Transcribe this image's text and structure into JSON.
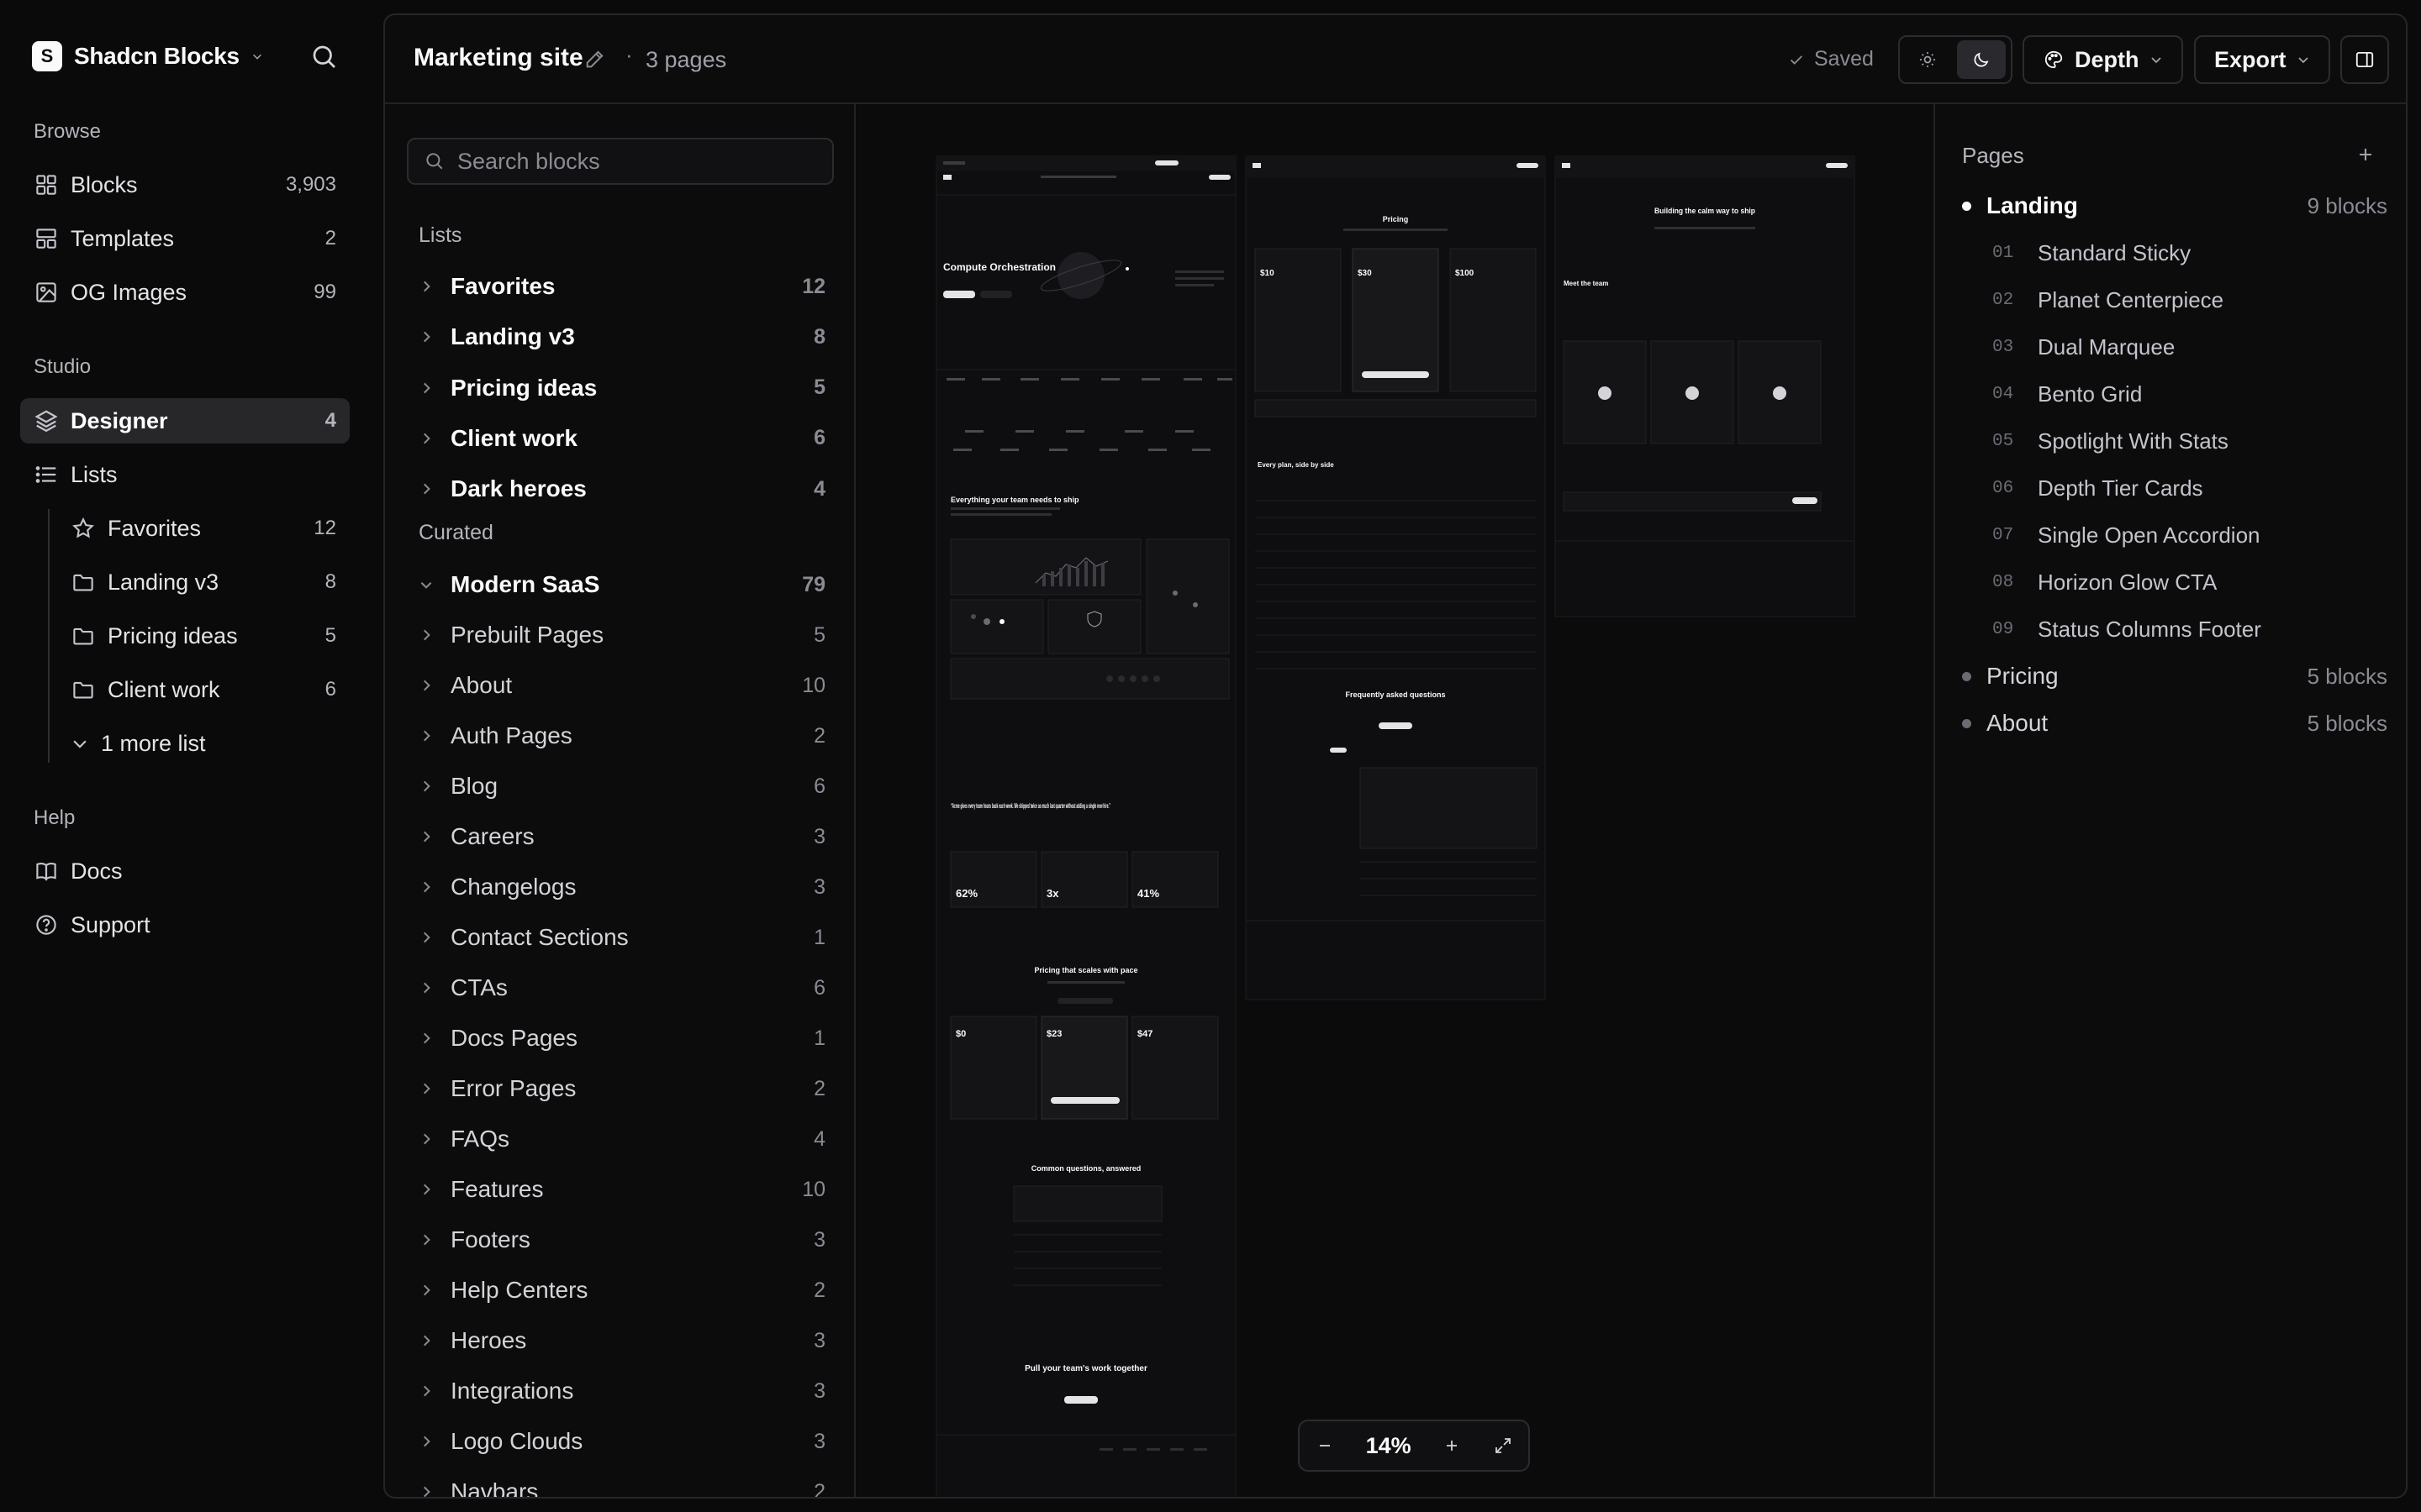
{
  "brand": {
    "logo_letter": "S",
    "name": "Shadcn Blocks"
  },
  "sidebar": {
    "browse_label": "Browse",
    "browse": [
      {
        "label": "Blocks",
        "count": "3,903",
        "icon": "grid-icon"
      },
      {
        "label": "Templates",
        "count": "2",
        "icon": "layout-icon"
      },
      {
        "label": "OG Images",
        "count": "99",
        "icon": "image-icon"
      }
    ],
    "studio_label": "Studio",
    "studio": [
      {
        "label": "Designer",
        "count": "4",
        "icon": "layers-icon",
        "active": true
      },
      {
        "label": "Lists",
        "count": "",
        "icon": "list-icon"
      }
    ],
    "lists": [
      {
        "label": "Favorites",
        "count": "12",
        "icon": "star-icon"
      },
      {
        "label": "Landing v3",
        "count": "8",
        "icon": "folder-icon"
      },
      {
        "label": "Pricing ideas",
        "count": "5",
        "icon": "folder-icon"
      },
      {
        "label": "Client work",
        "count": "6",
        "icon": "folder-icon"
      }
    ],
    "more_lists": "1 more list",
    "help_label": "Help",
    "help": [
      {
        "label": "Docs",
        "icon": "book-icon"
      },
      {
        "label": "Support",
        "icon": "help-circle-icon"
      }
    ]
  },
  "topbar": {
    "title": "Marketing site",
    "separator": "·",
    "pages": "3 pages",
    "saved": "Saved",
    "depth": "Depth",
    "export": "Export"
  },
  "blocks": {
    "search_placeholder": "Search blocks",
    "lists_label": "Lists",
    "lists": [
      {
        "label": "Favorites",
        "count": "12"
      },
      {
        "label": "Landing v3",
        "count": "8"
      },
      {
        "label": "Pricing ideas",
        "count": "5"
      },
      {
        "label": "Client work",
        "count": "6"
      },
      {
        "label": "Dark heroes",
        "count": "4"
      }
    ],
    "curated_label": "Curated",
    "curated": [
      {
        "label": "Modern SaaS",
        "count": "79",
        "open": true
      },
      {
        "label": "Prebuilt Pages",
        "count": "5"
      },
      {
        "label": "About",
        "count": "10"
      },
      {
        "label": "Auth Pages",
        "count": "2"
      },
      {
        "label": "Blog",
        "count": "6"
      },
      {
        "label": "Careers",
        "count": "3"
      },
      {
        "label": "Changelogs",
        "count": "3"
      },
      {
        "label": "Contact Sections",
        "count": "1"
      },
      {
        "label": "CTAs",
        "count": "6"
      },
      {
        "label": "Docs Pages",
        "count": "1"
      },
      {
        "label": "Error Pages",
        "count": "2"
      },
      {
        "label": "FAQs",
        "count": "4"
      },
      {
        "label": "Features",
        "count": "10"
      },
      {
        "label": "Footers",
        "count": "3"
      },
      {
        "label": "Help Centers",
        "count": "2"
      },
      {
        "label": "Heroes",
        "count": "3"
      },
      {
        "label": "Integrations",
        "count": "3"
      },
      {
        "label": "Logo Clouds",
        "count": "3"
      },
      {
        "label": "Navbars",
        "count": "2"
      }
    ]
  },
  "canvas": {
    "landing": {
      "hero": "Compute Orchestration",
      "features": "Everything your team needs to ship",
      "quote": "“Acme gives every team hours back each week. We shipped twice as much last quarter without adding a single new hire.”",
      "stats": [
        "62%",
        "3x",
        "41%"
      ],
      "pricing": "Pricing that scales with pace",
      "prices": [
        "$0",
        "$23",
        "$47"
      ],
      "faq": "Common questions, answered",
      "cta": "Pull your team's work together"
    },
    "pricing_page": {
      "title": "Pricing",
      "prices": [
        "$10",
        "$30",
        "$100"
      ],
      "compare": "Every plan, side by side",
      "faq": "Frequently asked questions"
    },
    "about_page": {
      "title": "Building the calm way to ship",
      "team": "Meet the team"
    },
    "zoom": "14%"
  },
  "pages_panel": {
    "title": "Pages",
    "pages": [
      {
        "label": "Landing",
        "count": "9 blocks",
        "current": true
      },
      {
        "label": "Pricing",
        "count": "5 blocks"
      },
      {
        "label": "About",
        "count": "5 blocks"
      }
    ],
    "landing_blocks": [
      {
        "num": "01",
        "label": "Standard Sticky"
      },
      {
        "num": "02",
        "label": "Planet Centerpiece"
      },
      {
        "num": "03",
        "label": "Dual Marquee"
      },
      {
        "num": "04",
        "label": "Bento Grid"
      },
      {
        "num": "05",
        "label": "Spotlight With Stats"
      },
      {
        "num": "06",
        "label": "Depth Tier Cards"
      },
      {
        "num": "07",
        "label": "Single Open Accordion"
      },
      {
        "num": "08",
        "label": "Horizon Glow CTA"
      },
      {
        "num": "09",
        "label": "Status Columns Footer"
      }
    ]
  },
  "colors": {
    "background": "#0a0a0b",
    "panel": "#0c0c0d",
    "active": "#27272a",
    "text": "#fafafa",
    "muted": "#8b8b93"
  }
}
